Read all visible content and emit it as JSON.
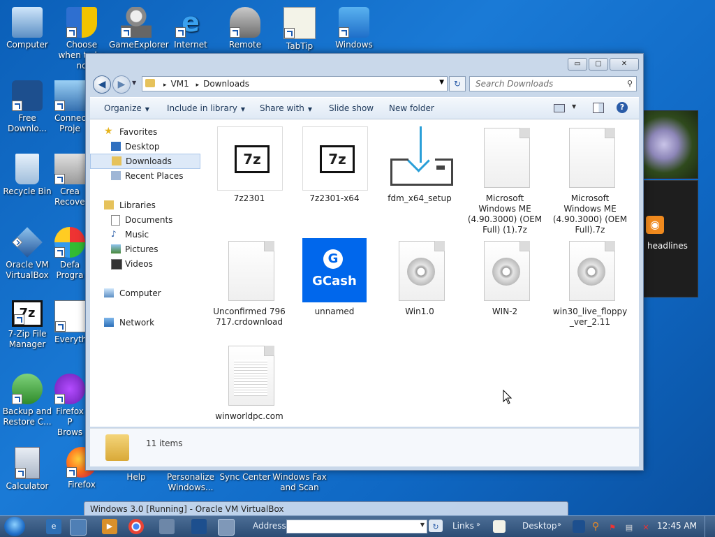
{
  "desktop": {
    "icons": [
      {
        "label": "Computer"
      },
      {
        "label": "Choose when to be no"
      },
      {
        "label": "GameExplorer"
      },
      {
        "label": "Internet"
      },
      {
        "label": "Remote"
      },
      {
        "label": "TabTip"
      },
      {
        "label": "Windows"
      },
      {
        "label": "Free Downlo..."
      },
      {
        "label": "Connec Proje"
      },
      {
        "label": "Recycle Bin"
      },
      {
        "label": "Crea Recover"
      },
      {
        "label": "Oracle VM VirtualBox"
      },
      {
        "label": "Defa Progra"
      },
      {
        "label": "7-Zip File Manager"
      },
      {
        "label": "Everyth"
      },
      {
        "label": "Backup and Restore C..."
      },
      {
        "label": "Firefox P Brows"
      },
      {
        "label": "Calculator"
      },
      {
        "label": "Firefox"
      },
      {
        "label": "Help"
      },
      {
        "label": "Personalize Windows..."
      },
      {
        "label": "Sync Center"
      },
      {
        "label": "Windows Fax and Scan"
      }
    ],
    "gadget_feed_label": "headlines"
  },
  "explorer": {
    "window_buttons": {
      "minimize": "▭",
      "maximize": "▢",
      "close": "✕"
    },
    "breadcrumb": [
      "VM1",
      "Downloads"
    ],
    "breadcrumb_sep": "▸",
    "search_placeholder": "Search Downloads",
    "toolbar": {
      "organize": "Organize",
      "include": "Include in library",
      "share": "Share with",
      "slideshow": "Slide show",
      "newfolder": "New folder"
    },
    "nav": {
      "favorites": "Favorites",
      "desktop": "Desktop",
      "downloads": "Downloads",
      "recent": "Recent Places",
      "libraries": "Libraries",
      "documents": "Documents",
      "music": "Music",
      "pictures": "Pictures",
      "videos": "Videos",
      "computer": "Computer",
      "network": "Network"
    },
    "files": [
      {
        "name": "7z2301",
        "icon": "7zip-installer-icon"
      },
      {
        "name": "7z2301-x64",
        "icon": "7zip-installer-icon"
      },
      {
        "name": "fdm_x64_setup",
        "icon": "download-tray-icon"
      },
      {
        "name": "Microsoft Windows ME (4.90.3000) (OEM Full) (1).7z",
        "icon": "blank-document-icon"
      },
      {
        "name": "Microsoft Windows ME (4.90.3000) (OEM Full).7z",
        "icon": "blank-document-icon"
      },
      {
        "name": "Unconfirmed 796717.crdownload",
        "icon": "blank-document-icon"
      },
      {
        "name": "unnamed",
        "icon": "gcash-icon"
      },
      {
        "name": "Win1.0",
        "icon": "disc-image-icon"
      },
      {
        "name": "WIN-2",
        "icon": "disc-image-icon"
      },
      {
        "name": "win30_live_floppy_ver_2.11",
        "icon": "disc-image-icon"
      },
      {
        "name": "winworldpc.com",
        "icon": "text-document-icon"
      }
    ],
    "gcash_text": "GCash",
    "gcash_glyph": "G",
    "zip_glyph": "7z",
    "status": "11 items"
  },
  "taskbar": {
    "ghost_title": "Windows 3.0 [Running] - Oracle VM VirtualBox",
    "address_label": "Address",
    "links_label": "Links",
    "desktop_label": "Desktop",
    "clock": "12:45 AM"
  }
}
